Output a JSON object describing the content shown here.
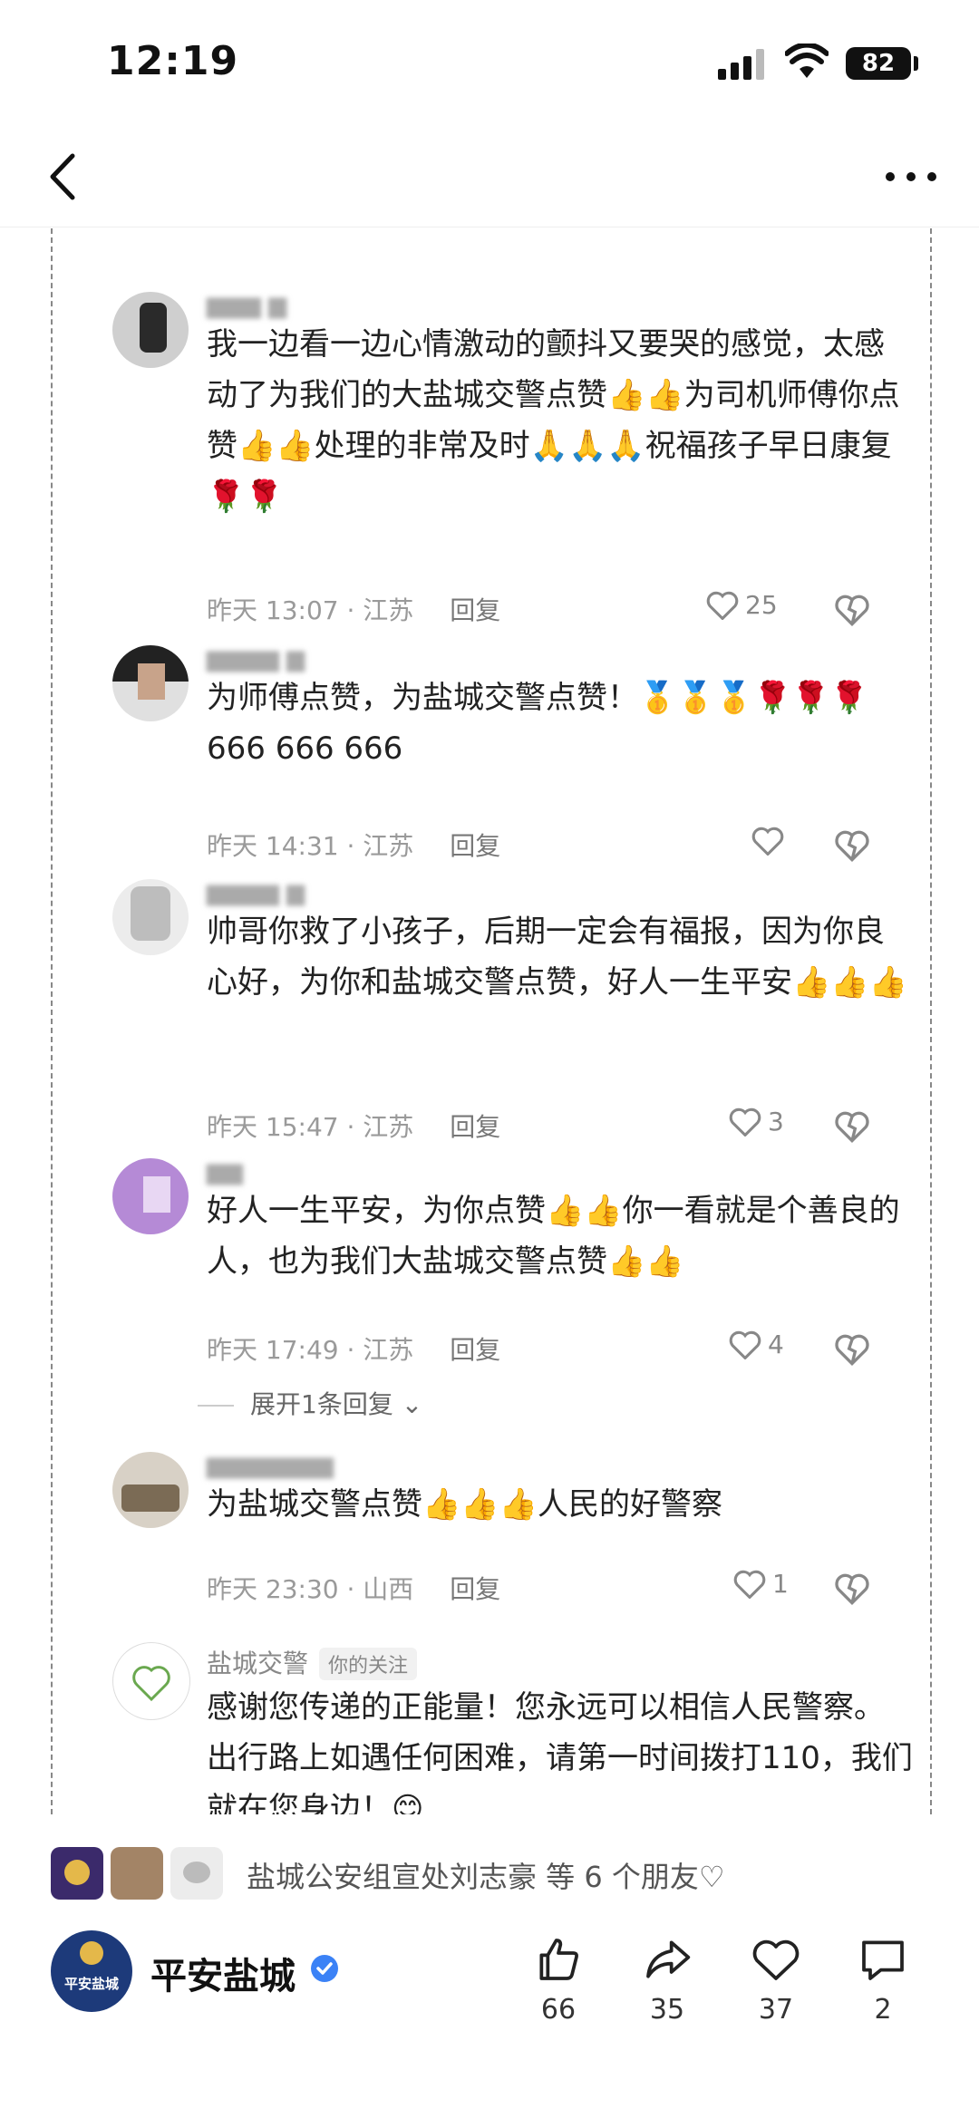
{
  "status_bar": {
    "time": "12:19",
    "battery": "82"
  },
  "comments": [
    {
      "text": "我一边看一边心情激动的颤抖又要哭的感觉，太感动了为我们的大盐城交警点赞👍👍为司机师傅你点赞👍👍处理的非常及时🙏🙏🙏祝福孩子早日康复🌹🌹",
      "time": "昨天 13:07 · 江苏",
      "reply_label": "回复",
      "likes": "25"
    },
    {
      "text": "为师傅点赞，为盐城交警点赞！🥇🥇🥇🌹🌹🌹 666 666 666",
      "time": "昨天 14:31 · 江苏",
      "reply_label": "回复",
      "likes": ""
    },
    {
      "text": "帅哥你救了小孩子，后期一定会有福报，因为你良心好，为你和盐城交警点赞，好人一生平安👍👍👍",
      "time": "昨天 15:47 · 江苏",
      "reply_label": "回复",
      "likes": "3"
    },
    {
      "text": "好人一生平安，为你点赞👍👍你一看就是个善良的人，也为我们大盐城交警点赞👍👍",
      "time": "昨天 17:49 · 江苏",
      "reply_label": "回复",
      "likes": "4",
      "expand_label": "展开1条回复"
    },
    {
      "text": "为盐城交警点赞👍👍👍人民的好警察",
      "time": "昨天 23:30 · 山西",
      "reply_label": "回复",
      "likes": "1"
    },
    {
      "nickname": "盐城交警",
      "tag": "你的关注",
      "text": "感谢您传递的正能量！您永远可以相信人民警察。出行路上如遇任何困难，请第一时间拨打110，我们就在您身边！😊"
    }
  ],
  "friends": {
    "text": "盐城公安组宣处刘志豪 等 6 个朋友♡"
  },
  "account": {
    "name": "平安盐城",
    "avatar_text": "平安盐城"
  },
  "actions": [
    {
      "name": "like",
      "count": "66"
    },
    {
      "name": "share",
      "count": "35"
    },
    {
      "name": "favorite",
      "count": "37"
    },
    {
      "name": "comment",
      "count": "2"
    }
  ],
  "colors": {
    "accent_verified": "#3b82f6",
    "account_avatar_bg": "#1d3a7a"
  }
}
